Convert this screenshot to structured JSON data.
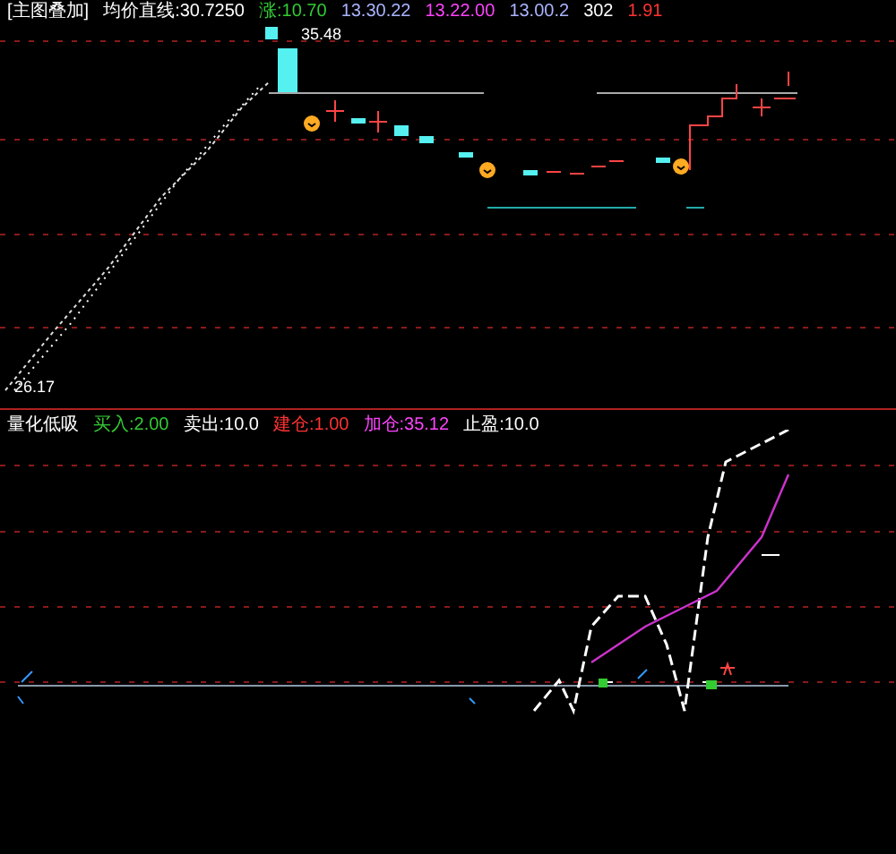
{
  "price_panel": {
    "legend": [
      {
        "text": "[主图叠加]",
        "color": "#ffffff"
      },
      {
        "text": "均价直线:30.7250",
        "color": "#ffffff"
      },
      {
        "text": "涨:10.70",
        "color": "#33cc33"
      },
      {
        "text": "13.30.22",
        "color": "#aab4ff"
      },
      {
        "text": "13.22.00",
        "color": "#ff44ff"
      },
      {
        "text": "13.00.2",
        "color": "#aab4ff"
      },
      {
        "text": "302",
        "color": "#ffffff"
      },
      {
        "text": "1.91",
        "color": "#ff3333"
      }
    ],
    "high_label": "35.48",
    "low_label": "26.17"
  },
  "indicator_panel": {
    "legend": [
      {
        "text": "量化低吸",
        "color": "#ffffff"
      },
      {
        "text": "买入:2.00",
        "color": "#33cc33"
      },
      {
        "text": "卖出:10.0",
        "color": "#ffffff"
      },
      {
        "text": "建仓:1.00",
        "color": "#ff3333"
      },
      {
        "text": "加仓:35.12",
        "color": "#ff44ff"
      },
      {
        "text": "止盈:10.0",
        "color": "#ffffff"
      }
    ]
  }
}
